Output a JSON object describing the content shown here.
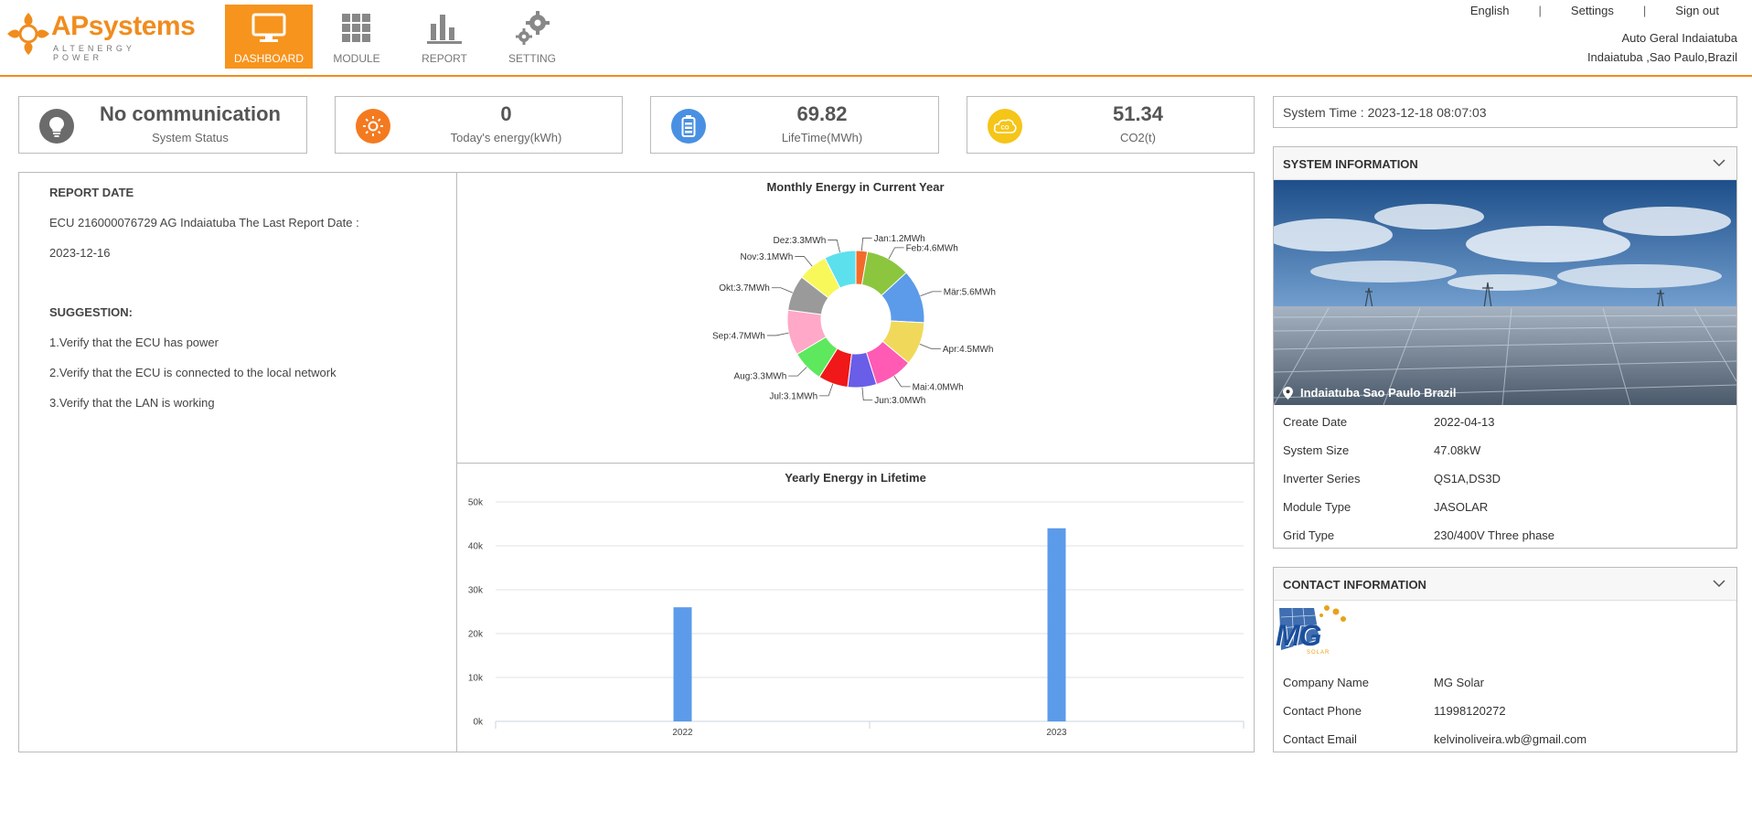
{
  "header": {
    "logo_text_ap": "AP",
    "logo_text_systems": "systems",
    "logo_sub": "ALTENERGY POWER",
    "nav": [
      {
        "label": "DASHBOARD",
        "icon": "monitor-icon",
        "active": true
      },
      {
        "label": "MODULE",
        "icon": "grid-icon",
        "active": false
      },
      {
        "label": "REPORT",
        "icon": "bar-chart-icon",
        "active": false
      },
      {
        "label": "SETTING",
        "icon": "gears-icon",
        "active": false
      }
    ],
    "links": {
      "language": "English",
      "settings": "Settings",
      "signout": "Sign out",
      "separator": "|"
    },
    "user_name": "Auto Geral Indaiatuba",
    "user_location": "Indaiatuba ,Sao Paulo,Brazil"
  },
  "status_cards": [
    {
      "value": "No communication",
      "label": "System Status",
      "icon": "lightbulb-icon",
      "color": "#6b6b6b"
    },
    {
      "value": "0",
      "label": "Today's energy(kWh)",
      "icon": "sun-icon",
      "color": "#f47a20"
    },
    {
      "value": "69.82",
      "label": "LifeTime(MWh)",
      "icon": "battery-icon",
      "color": "#4a90e2"
    },
    {
      "value": "51.34",
      "label": "CO2(t)",
      "icon": "co2-icon",
      "color": "#f5c518"
    }
  ],
  "system_time": "System Time : 2023-12-18 08:07:03",
  "report": {
    "date_heading": "REPORT DATE",
    "ecu_line": "ECU 216000076729 AG Indaiatuba The Last Report Date :",
    "date": "2023-12-16",
    "suggestion_heading": "SUGGESTION:",
    "suggestions": [
      "1.Verify that the ECU has power",
      "2.Verify that the ECU is connected to the local network",
      "3.Verify that the LAN is working"
    ]
  },
  "chart_data": [
    {
      "type": "pie",
      "title": "Monthly Energy in Current Year",
      "categories": [
        "Jan",
        "Feb",
        "Mär",
        "Apr",
        "Mai",
        "Jun",
        "Jul",
        "Aug",
        "Sep",
        "Okt",
        "Nov",
        "Dez"
      ],
      "values": [
        1.2,
        4.6,
        5.6,
        4.5,
        4.0,
        3.0,
        3.1,
        3.3,
        4.7,
        3.7,
        3.1,
        3.3
      ],
      "labels": [
        "Jan:1.2MWh",
        "Feb:4.6MWh",
        "Mär:5.6MWh",
        "Apr:4.5MWh",
        "Mai:4.0MWh",
        "Jun:3.0MWh",
        "Jul:3.1MWh",
        "Aug:3.3MWh",
        "Sep:4.7MWh",
        "Okt:3.7MWh",
        "Nov:3.1MWh",
        "Dez:3.3MWh"
      ],
      "unit": "MWh",
      "colors": [
        "#f26b2a",
        "#8cc63f",
        "#5b9bea",
        "#f0d95a",
        "#ff5ab4",
        "#6a5de8",
        "#f01818",
        "#5ee85e",
        "#ffa8c8",
        "#9a9a9a",
        "#f8f85a",
        "#5ce0ee"
      ]
    },
    {
      "type": "bar",
      "title": "Yearly Energy in Lifetime",
      "categories": [
        "2022",
        "2023"
      ],
      "values": [
        26000,
        44000
      ],
      "ylim": [
        0,
        50000
      ],
      "yticks": [
        "0k",
        "10k",
        "20k",
        "30k",
        "40k",
        "50k"
      ],
      "grid": true,
      "color": "#5b9bea"
    }
  ],
  "system_info": {
    "title": "SYSTEM INFORMATION",
    "photo_location": "Indaiatuba Sao Paulo Brazil",
    "rows": [
      {
        "k": "Create Date",
        "v": "2022-04-13"
      },
      {
        "k": "System Size",
        "v": "47.08kW"
      },
      {
        "k": "Inverter Series",
        "v": "QS1A,DS3D"
      },
      {
        "k": "Module Type",
        "v": "JASOLAR"
      },
      {
        "k": "Grid Type",
        "v": "230/400V Three phase"
      }
    ]
  },
  "contact_info": {
    "title": "CONTACT INFORMATION",
    "logo_text": "MG",
    "logo_sub": "SOLAR",
    "rows": [
      {
        "k": "Company Name",
        "v": "MG Solar"
      },
      {
        "k": "Contact Phone",
        "v": "11998120272"
      },
      {
        "k": "Contact Email",
        "v": "kelvinoliveira.wb@gmail.com"
      }
    ]
  }
}
